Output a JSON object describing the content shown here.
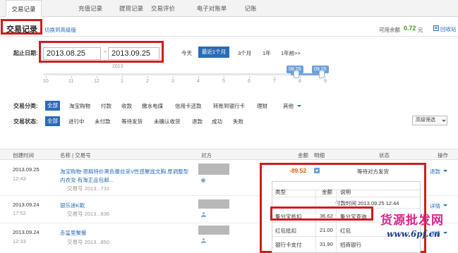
{
  "tabs": [
    {
      "label": "交易记录"
    },
    {
      "label": "充值记录"
    },
    {
      "label": "提现记录"
    },
    {
      "label": "交易评价"
    },
    {
      "label": "电子对账单"
    },
    {
      "label": "记账"
    }
  ],
  "header": {
    "title": "交易记录",
    "switch_link": "切换到高级版",
    "balance_label": "可用余额",
    "balance_value": "0.72",
    "balance_unit": "元",
    "recycle_link": "回收站"
  },
  "date_filter": {
    "label": "起止日期:",
    "start": "2013.08.25",
    "end": "2013.09.25",
    "quick_options": [
      "今天",
      "最近1个月",
      "3个月",
      "1年",
      "1年前>>"
    ],
    "active_option": "最近1个月"
  },
  "slider": {
    "year": "2013",
    "months": [
      "10",
      "11",
      "12",
      "1",
      "2",
      "3",
      "4",
      "5",
      "6",
      "7",
      "8",
      "9"
    ],
    "start_tag": "08.25",
    "end_tag": "09.25"
  },
  "category_filter": {
    "label": "交易分类:",
    "active": "全部",
    "options": [
      "淘宝购物",
      "付款",
      "收款",
      "缴水电煤",
      "信用卡还款",
      "转账到银行卡",
      "理财",
      "其他"
    ]
  },
  "status_filter": {
    "label": "交易状态:",
    "active": "全部",
    "options": [
      "进行中",
      "未付款",
      "等待发货",
      "未确认收货",
      "退款",
      "成功",
      "失败"
    ],
    "advanced": "高级筛选"
  },
  "table": {
    "columns": [
      "创建时间",
      "名称 | 交易号",
      "对方",
      "金额",
      "明细",
      "状态",
      "操作"
    ],
    "rows": [
      {
        "date": "2013.09.25",
        "time": "12:43",
        "name_line1": "淘宝购物-思精特价黑色蕾丝采V性感聚拢文胸 厚调整型",
        "name_line2": "内衣女 有淘正品包邮...",
        "trade_no": "交易号 2013...731",
        "amount": "-89.52",
        "status": "等待对方发货",
        "action": "退款"
      },
      {
        "date": "2013.09.24",
        "time": "17:52",
        "name_line1": "银乐迪K歌",
        "name_line2": "",
        "trade_no": "交易号 2013...836",
        "amount": "",
        "status": "",
        "action": "详情"
      },
      {
        "date": "2013.09.24",
        "time": "12:33",
        "name_line1": "赤玺里聚餐",
        "name_line2": "",
        "trade_no": "交易号 2013...850",
        "amount": "",
        "status": "",
        "action": "详情"
      }
    ]
  },
  "payment_popup": {
    "columns": [
      "类型",
      "金额",
      "说明"
    ],
    "paid_time_label": "付款时间 2013.09.25 12:44",
    "rows": [
      {
        "type": "集分宝抵扣",
        "amount": "36.62",
        "note": "集分宝查询"
      },
      {
        "type": "红包抵扣",
        "amount": "21.00",
        "note": "红包"
      },
      {
        "type": "银行卡支付",
        "amount": "31.90",
        "note": "招商银行"
      }
    ]
  },
  "watermark": {
    "text": "货源批发网",
    "url": "www.6pf.cn"
  },
  "colors": {
    "accent": "#2a6bb8",
    "highlight_box": "#d01c1c",
    "amount_negative": "#e8590c",
    "balance": "#3a9a1f"
  }
}
